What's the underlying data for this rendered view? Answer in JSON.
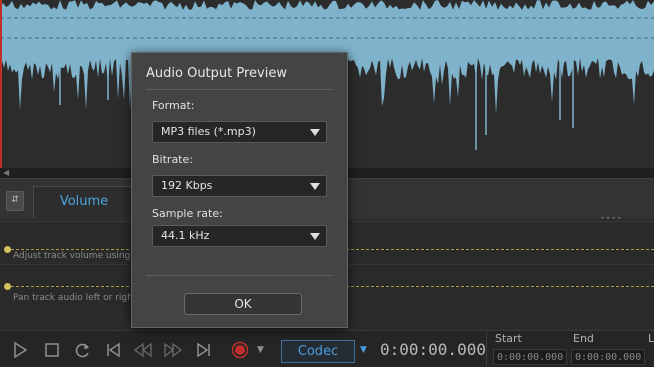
{
  "dialog": {
    "title": "Audio Output Preview",
    "format": {
      "label": "Format:",
      "value": "MP3 files (*.mp3)"
    },
    "bitrate": {
      "label": "Bitrate:",
      "value": "192 Kbps"
    },
    "sample_rate": {
      "label": "Sample rate:",
      "value": "44.1 kHz"
    },
    "ok_label": "OK"
  },
  "tabs": {
    "volume_label": "Volume"
  },
  "lanes": {
    "volume_hint": "Adjust track volume using the envelope",
    "pan_hint": "Pan track audio left or right"
  },
  "transport": {
    "codec_label": "Codec",
    "timecode": "0:00:00.000",
    "start_label": "Start",
    "start_value": "0:00:00.000",
    "end_label": "End",
    "end_value": "0:00:00.000",
    "length_label": "L"
  },
  "icons": {
    "play": "play-icon",
    "stop": "stop-icon",
    "loop": "loop-icon",
    "skip_start": "skip-to-start-icon",
    "rewind": "rewind-icon",
    "fast_forward": "fast-forward-icon",
    "skip_end": "skip-to-end-icon",
    "record": "record-icon"
  },
  "colors": {
    "waveform": "#7fb3cc",
    "accent": "#4a9bdd",
    "record": "#c0302a",
    "envelope": "#a89a3a"
  }
}
